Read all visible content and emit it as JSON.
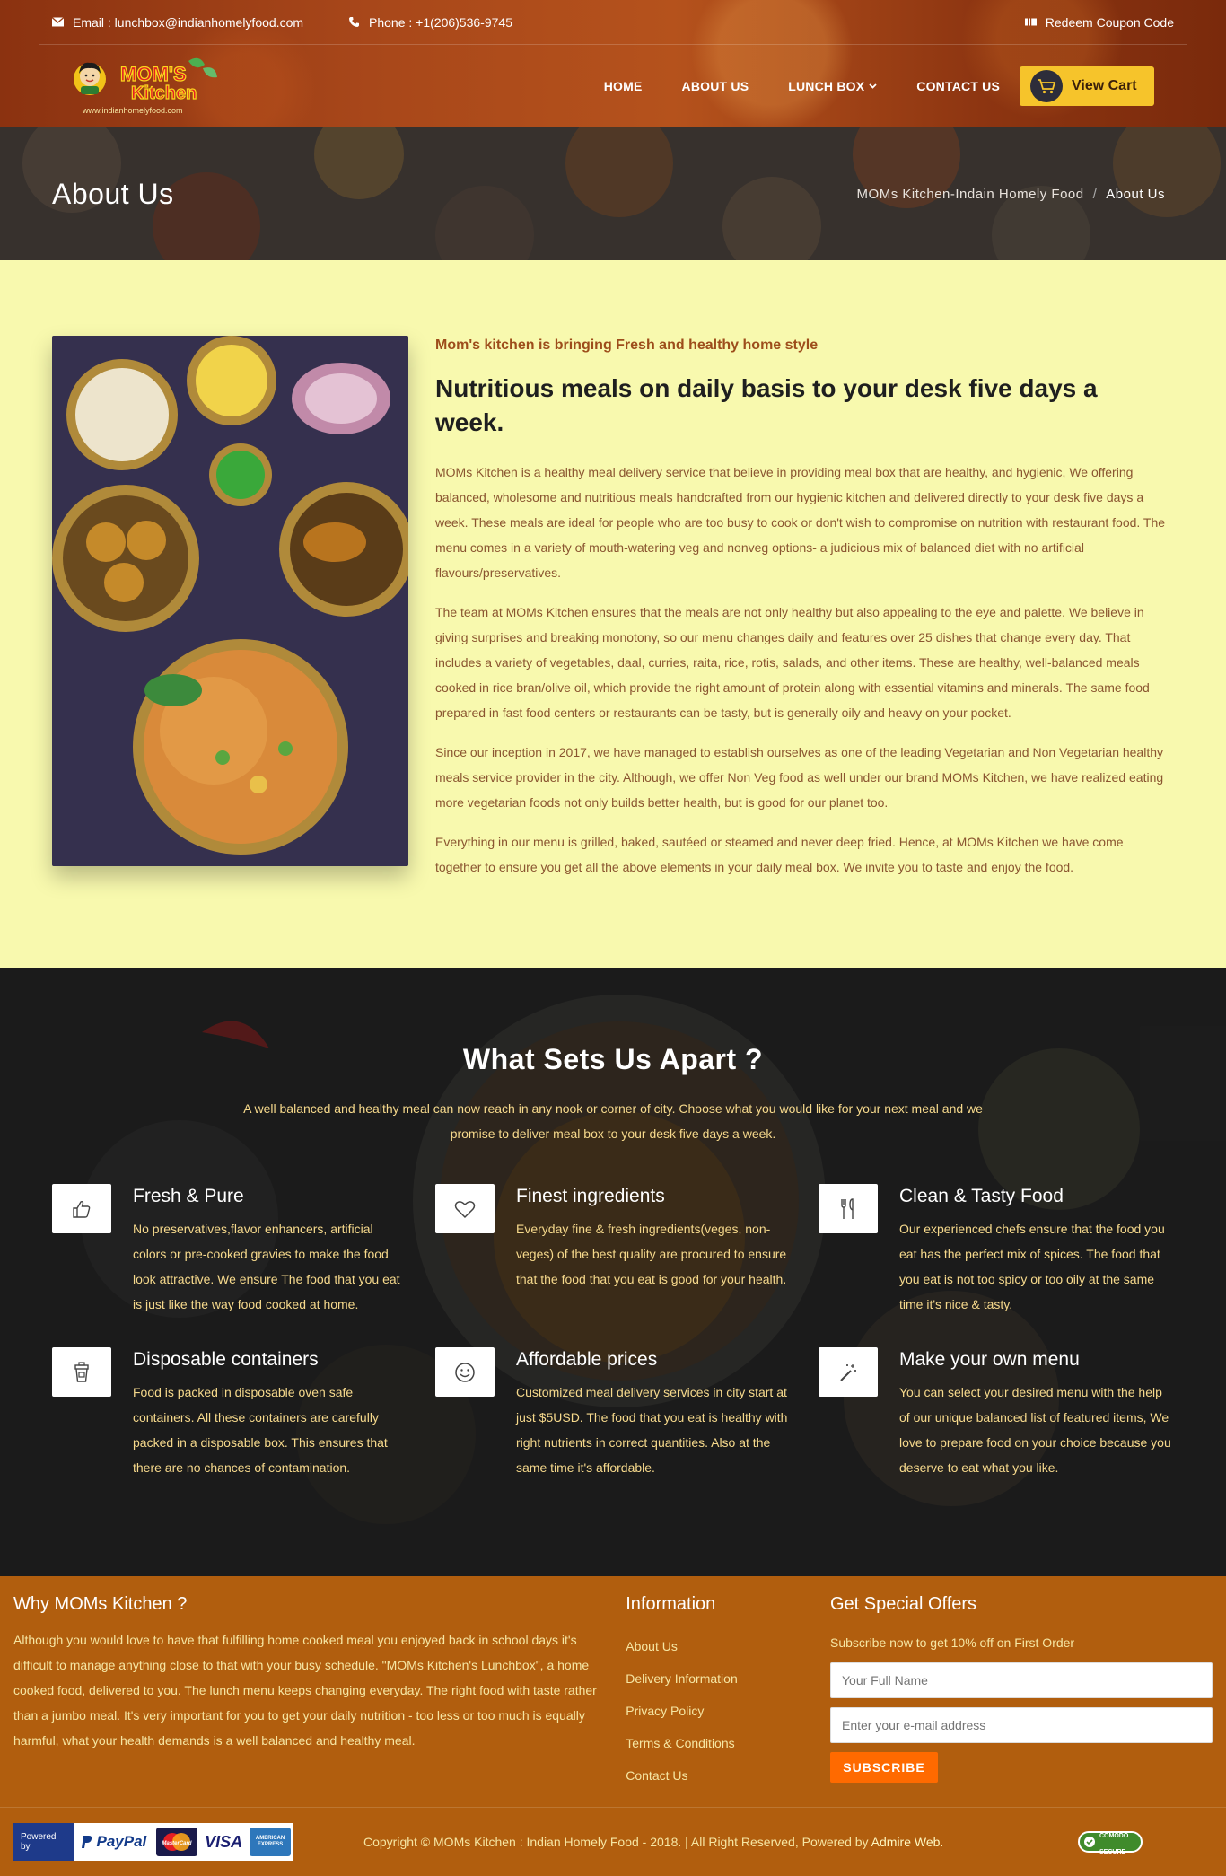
{
  "topbar": {
    "email": "Email : lunchbox@indianhomelyfood.com",
    "phone": "Phone : +1(206)536-9745",
    "coupon": "Redeem Coupon Code"
  },
  "logo": {
    "text1": "MOM'S",
    "text2": "Kitchen",
    "url": "www.indianhomelyfood.com"
  },
  "nav": {
    "items": [
      "HOME",
      "ABOUT US",
      "LUNCH BOX",
      "CONTACT US"
    ],
    "cart": "View Cart"
  },
  "banner": {
    "title": "About Us",
    "crumb_home": "MOMs Kitchen-Indain Homely Food",
    "crumb_sep": "/",
    "crumb_current": "About Us"
  },
  "about": {
    "kicker": "Mom's kitchen is bringing Fresh and healthy home style",
    "heading": "Nutritious meals on daily basis to your desk five days a week.",
    "paragraphs": [
      "MOMs Kitchen is a healthy meal delivery service that believe in providing meal box that are healthy, and hygienic, We offering balanced, wholesome and nutritious meals handcrafted from our hygienic kitchen and delivered directly to your desk five days a week. These meals are ideal for people who are too busy to cook or don't wish to compromise on nutrition with restaurant food. The menu comes in a variety of mouth-watering veg and nonveg options- a judicious mix of balanced diet with no artificial flavours/preservatives.",
      "The team at MOMs Kitchen ensures that the meals are not only healthy but also appealing to the eye and palette. We believe in giving surprises and breaking monotony, so our menu changes daily and features over 25 dishes that change every day. That includes a variety of vegetables, daal, curries, raita, rice, rotis, salads, and other items. These are healthy, well-balanced meals cooked in rice bran/olive oil, which provide the right amount of protein along with essential vitamins and minerals. The same food prepared in fast food centers or restaurants can be tasty, but is generally oily and heavy on your pocket.",
      "Since our inception in 2017, we have managed to establish ourselves as one of the leading Vegetarian and Non Vegetarian healthy meals service provider in the city. Although, we offer Non Veg food as well under our brand MOMs Kitchen, we have realized eating more vegetarian foods not only builds better health, but is good for our planet too.",
      "Everything in our menu is grilled, baked, sautéed or steamed and never deep fried. Hence, at MOMs Kitchen we have come together to ensure you get all the above elements in your daily meal box. We invite you to taste and enjoy the food."
    ]
  },
  "features": {
    "title": "What Sets Us Apart ?",
    "lead": "A well balanced and healthy meal can now reach in any nook or corner of city. Choose what you would like for your next meal and we promise to deliver meal box to your desk five days a week.",
    "items": [
      {
        "icon": "thumbs-up-icon",
        "title": "Fresh & Pure",
        "text": "No preservatives,flavor enhancers, artificial colors or pre-cooked gravies to make the food look attractive. We ensure The food that you eat is just like the way food cooked at home."
      },
      {
        "icon": "heart-icon",
        "title": "Finest ingredients",
        "text": "Everyday fine & fresh ingredients(veges, non-veges) of the best quality are procured to ensure that the food that you eat is good for your health."
      },
      {
        "icon": "fork-knife-icon",
        "title": "Clean & Tasty Food",
        "text": "Our experienced chefs ensure that the food you eat has the perfect mix of spices. The food that you eat is not too spicy or too oily at the same time it's nice & tasty."
      },
      {
        "icon": "container-icon",
        "title": "Disposable containers",
        "text": "Food is packed in disposable oven safe containers. All these containers are carefully packed in a disposable box. This ensures that there are no chances of contamination."
      },
      {
        "icon": "smiley-icon",
        "title": "Affordable prices",
        "text": "Customized meal delivery services in city start at just $5USD. The food that you eat is healthy with right nutrients in correct quantities. Also at the same time it's affordable."
      },
      {
        "icon": "magic-wand-icon",
        "title": "Make your own menu",
        "text": "You can select your desired menu with the help of our unique balanced list of featured items, We love to prepare food on your choice because you deserve to eat what you like."
      }
    ]
  },
  "footer": {
    "why_title": "Why MOMs Kitchen ?",
    "why_text": "Although you would love to have that fulfilling home cooked meal you enjoyed back in school days it's difficult to manage anything close to that with your busy schedule. \"MOMs Kitchen's Lunchbox\", a home cooked food, delivered to you. The lunch menu keeps changing everyday. The right food with taste rather than a jumbo meal. It's very important for you to get your daily nutrition - too less or too much is equally harmful, what your health demands is a well balanced and healthy meal.",
    "info_title": "Information",
    "info_links": [
      "About Us",
      "Delivery Information",
      "Privacy Policy",
      "Terms & Conditions",
      "Contact Us"
    ],
    "offers_title": "Get Special Offers",
    "offers_sub": "Subscribe now to get 10% off on First Order",
    "name_placeholder": "Your Full Name",
    "email_placeholder": "Enter your e-mail address",
    "subscribe": "SUBSCRIBE",
    "powered_by": "Powered by",
    "paypal": "PayPal",
    "cards": [
      "MasterCard",
      "VISA",
      "AMERICAN EXPRESS"
    ],
    "copyright": "Copyright © MOMs Kitchen : Indian Homely Food - 2018. | All Right Reserved, Powered by ",
    "copyright_brand": "Admire Web.",
    "secure_text1": "COMODO",
    "secure_text2": "SECURE"
  },
  "colors": {
    "about_bg": "#f8f9ae",
    "footer_bg": "#b15e0e",
    "accent": "#f6c42b",
    "subscribe": "#ff6a00"
  }
}
